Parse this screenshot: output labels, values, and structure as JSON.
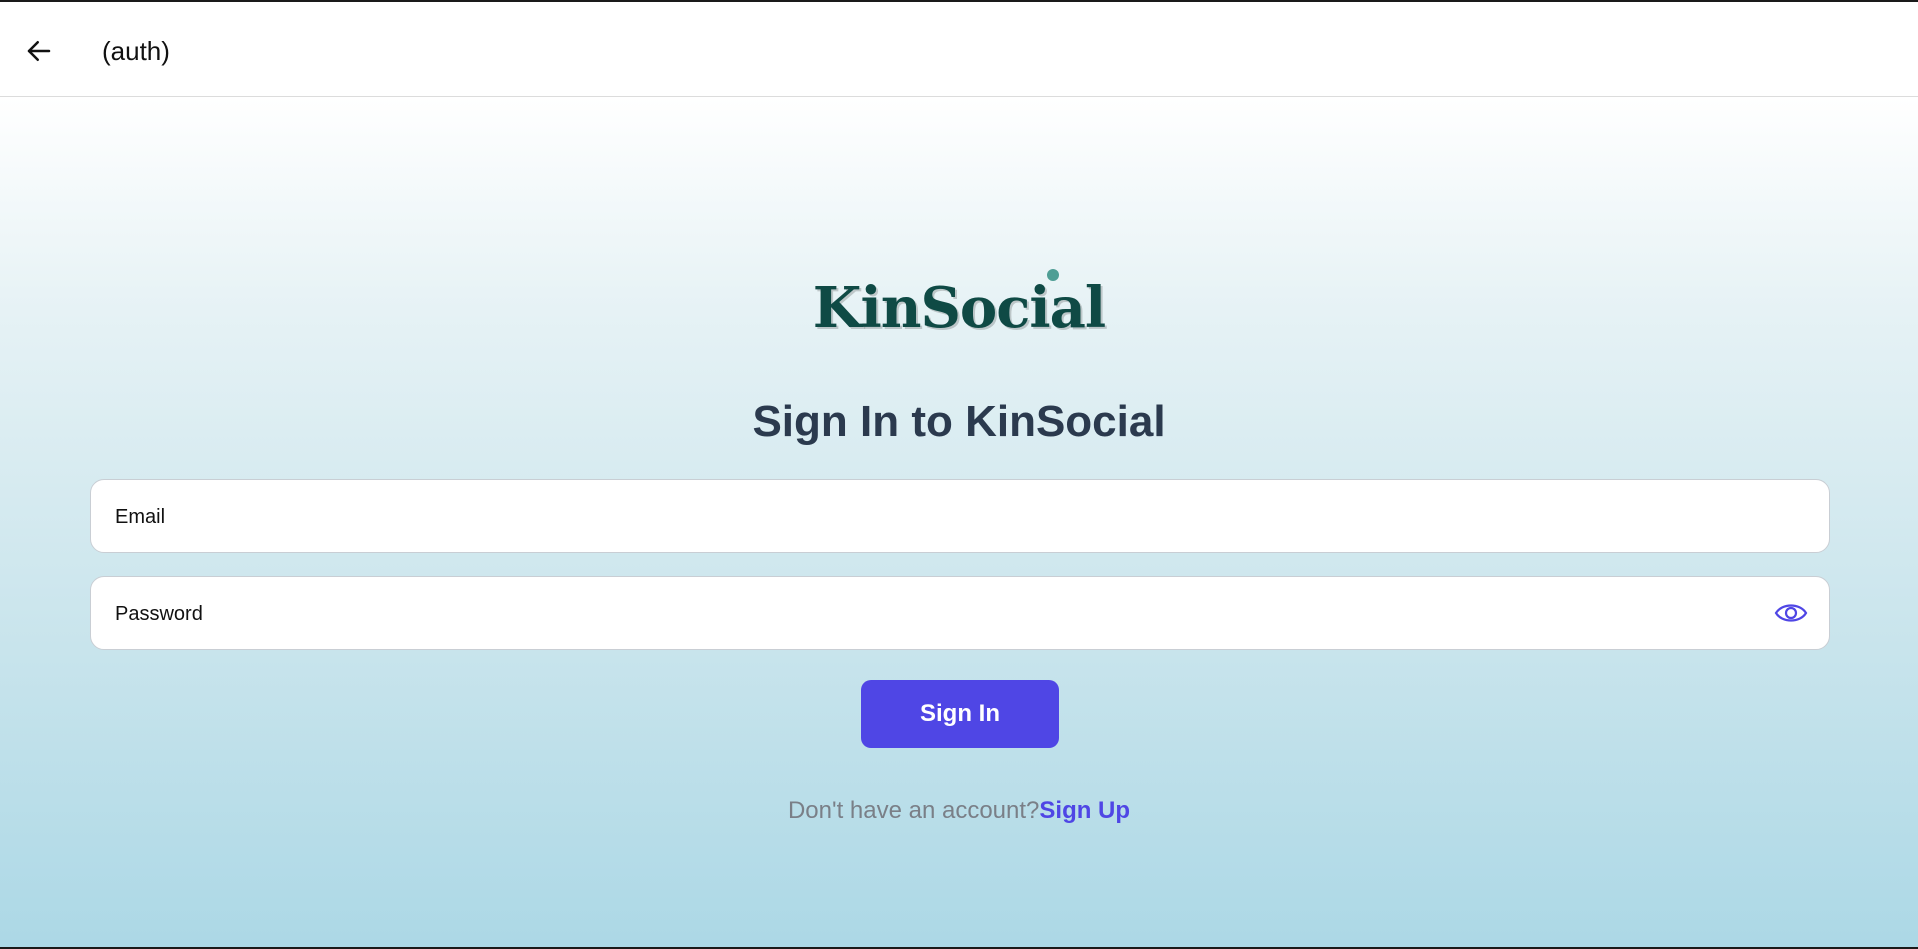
{
  "header": {
    "title": "(auth)",
    "back_icon": "arrow-left-icon"
  },
  "logo": {
    "text": "KinSocial"
  },
  "page": {
    "title": "Sign In to KinSocial"
  },
  "form": {
    "email_placeholder": "Email",
    "email_value": "",
    "password_placeholder": "Password",
    "password_value": "",
    "password_toggle_icon": "eye-icon",
    "submit_label": "Sign In"
  },
  "footer": {
    "prompt": "Don't have an account?",
    "signup_label": "Sign Up"
  },
  "colors": {
    "accent": "#4f46e5",
    "logo": "#0f4a45",
    "title": "#2b3a4e"
  }
}
